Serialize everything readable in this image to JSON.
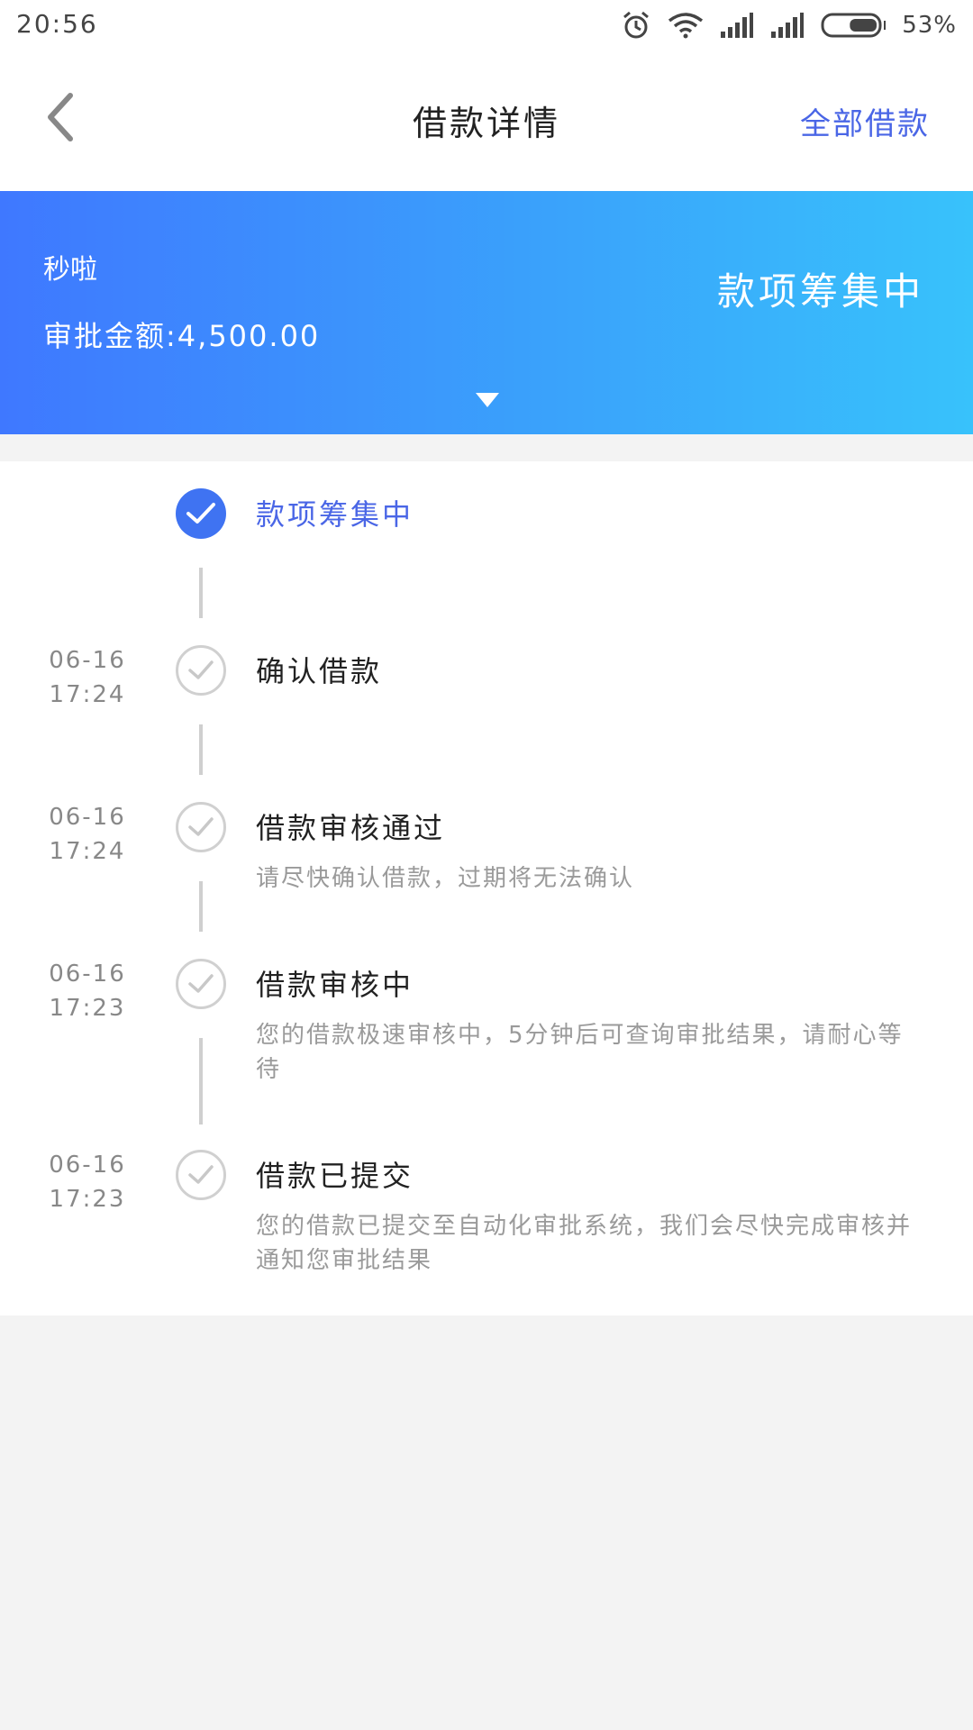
{
  "status_bar": {
    "time": "20:56",
    "battery_percent": "53%",
    "battery_level": 0.53,
    "icons": [
      "alarm-icon",
      "wifi-icon",
      "signal-icon",
      "signal-icon",
      "battery-icon"
    ]
  },
  "header": {
    "title": "借款详情",
    "right_link": "全部借款",
    "back_icon": "back-chevron-icon"
  },
  "banner": {
    "merchant": "秒啦",
    "amount_text": "审批金额:4,500.00",
    "status": "款项筹集中",
    "toggle_icon": "triangle-down-icon"
  },
  "timeline": [
    {
      "state": "active",
      "date": "",
      "time": "",
      "title": "款项筹集中",
      "desc": ""
    },
    {
      "state": "done",
      "date": "06-16",
      "time": "17:24",
      "title": "确认借款",
      "desc": ""
    },
    {
      "state": "done",
      "date": "06-16",
      "time": "17:24",
      "title": "借款审核通过",
      "desc": "请尽快确认借款，过期将无法确认"
    },
    {
      "state": "done",
      "date": "06-16",
      "time": "17:23",
      "title": "借款审核中",
      "desc": "您的借款极速审核中，5分钟后可查询审批结果，请耐心等待"
    },
    {
      "state": "done",
      "date": "06-16",
      "time": "17:23",
      "title": "借款已提交",
      "desc": "您的借款已提交至自动化审批系统，我们会尽快完成审核并通知您审批结果"
    }
  ],
  "colors": {
    "accent": "#4a66e6",
    "active_circle": "#3f73f2",
    "banner_start": "#3f78ff",
    "banner_end": "#38c2fb",
    "background": "#f3f3f3"
  }
}
